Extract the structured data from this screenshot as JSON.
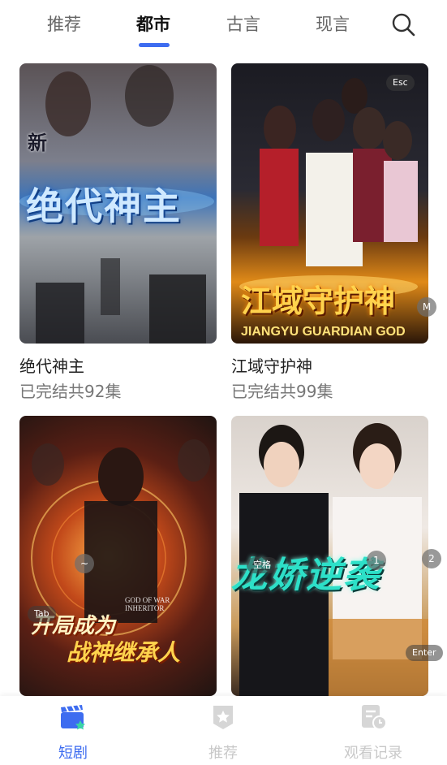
{
  "top_tabs": [
    {
      "label": "推荐",
      "active": false
    },
    {
      "label": "都市",
      "active": true
    },
    {
      "label": "古言",
      "active": false
    },
    {
      "label": "现言",
      "active": false
    }
  ],
  "search": {
    "icon": "search-icon"
  },
  "cards": [
    {
      "title": "绝代神主",
      "subtitle": "已完结共92集",
      "poster_text": "绝代神主",
      "poster_tag": "新"
    },
    {
      "title": "江域守护神",
      "subtitle": "已完结共99集",
      "poster_text": "江域守护神",
      "poster_sub": "JIANGYU GUARDIAN GOD"
    },
    {
      "title": "开局成为战神继承人",
      "subtitle": "",
      "poster_text": "开局成为",
      "poster_text2": "战神继承人",
      "poster_sub": "GOD OF WAR INHERITOR"
    },
    {
      "title": "龙娇逆袭",
      "subtitle": "",
      "poster_text": "龙娇逆袭"
    }
  ],
  "overlay_keys": {
    "esc": "Esc",
    "m": "M",
    "tilde": "~",
    "tab": "Tab",
    "space": "空格",
    "one": "1",
    "two": "2",
    "enter": "Enter"
  },
  "bottom_nav": [
    {
      "label": "短剧",
      "icon": "clapperboard-icon",
      "active": true
    },
    {
      "label": "推荐",
      "icon": "star-badge-icon",
      "active": false
    },
    {
      "label": "观看记录",
      "icon": "history-doc-icon",
      "active": false
    }
  ],
  "colors": {
    "accent": "#3d6cf0",
    "inactive": "#c8c8c8"
  }
}
